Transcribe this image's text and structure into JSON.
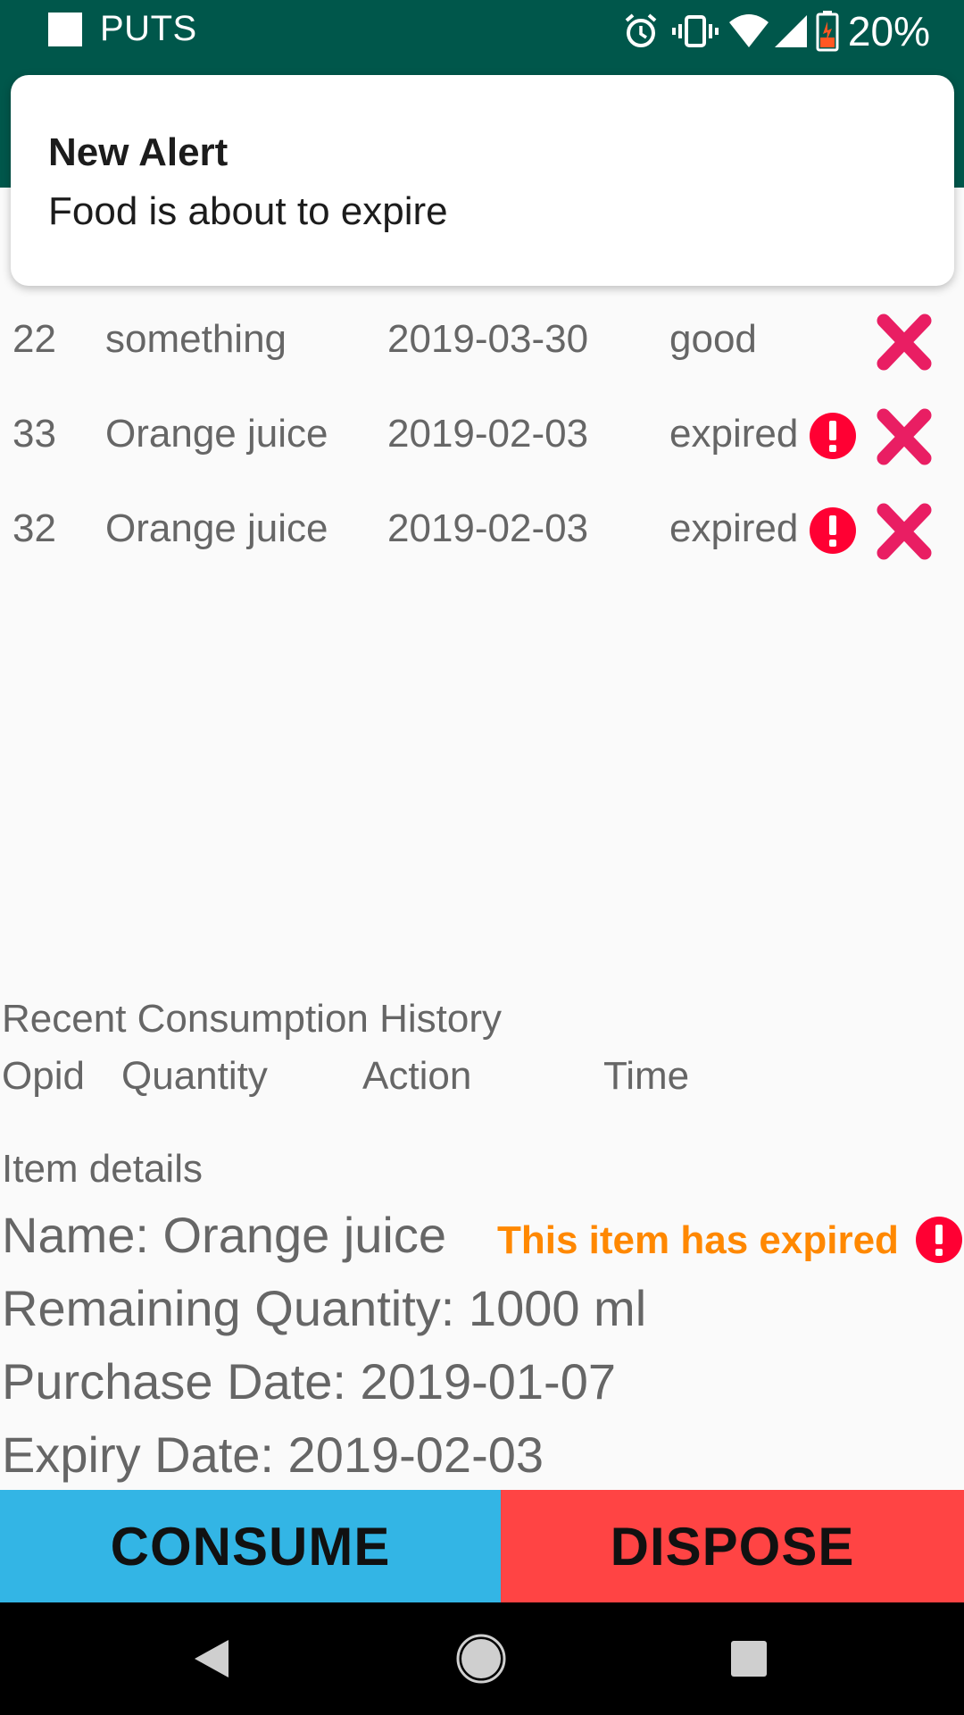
{
  "status_bar": {
    "app_name": "PUTS",
    "battery": "20%",
    "icons": [
      "alarm-icon",
      "vibrate-icon",
      "wifi-icon",
      "signal-icon",
      "battery-icon"
    ]
  },
  "notification": {
    "title": "New Alert",
    "body": "Food is about to expire"
  },
  "food_items": [
    {
      "id": "22",
      "name": "something",
      "date": "2019-03-30",
      "status": "good",
      "warning": false
    },
    {
      "id": "33",
      "name": "Orange juice",
      "date": "2019-02-03",
      "status": "expired",
      "warning": true
    },
    {
      "id": "32",
      "name": "Orange juice",
      "date": "2019-02-03",
      "status": "expired",
      "warning": true
    }
  ],
  "history": {
    "title": "Recent Consumption History",
    "columns": [
      "Opid",
      "Quantity",
      "Action",
      "Time"
    ]
  },
  "details": {
    "title": "Item details",
    "name": "Name: Orange juice",
    "expired_message": "This item has expired",
    "remaining": "Remaining Quantity: 1000 ml",
    "purchase": "Purchase Date: 2019-01-07",
    "expiry": "Expiry Date: 2019-02-03"
  },
  "buttons": {
    "consume": "CONSUME",
    "dispose": "DISPOSE"
  },
  "colors": {
    "primary": "#00574b",
    "consume": "#33b5e5",
    "dispose": "#ff4444",
    "warning": "#ff0033",
    "delete": "#e91e63",
    "expired_text": "#ff8800"
  }
}
